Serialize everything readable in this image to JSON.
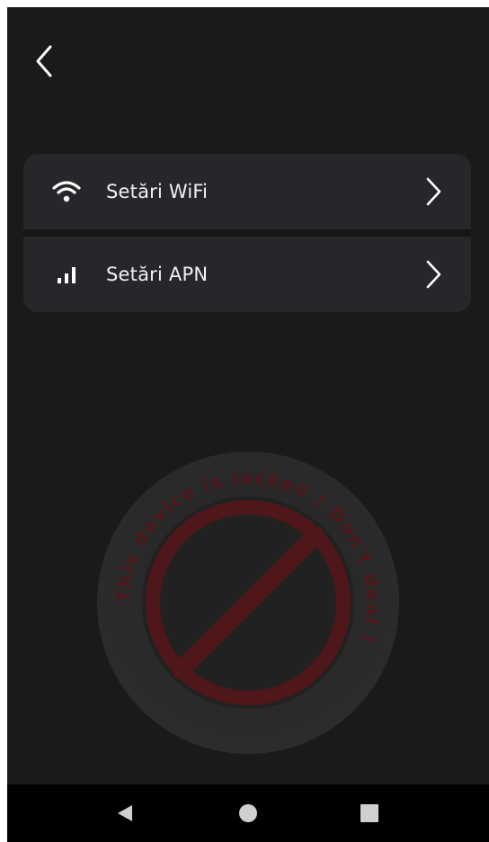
{
  "colors": {
    "background": "#1a1a1a",
    "card": "#26272b",
    "text": "#f1f1f1",
    "stamp_red": "#5a1a1c",
    "stamp_gray": "#2a2a2a",
    "nav_bar": "#000000"
  },
  "header": {
    "back_icon": "chevron-left-icon"
  },
  "menu": {
    "items": [
      {
        "label": "Setări WiFi",
        "icon": "wifi-icon",
        "chevron": "chevron-right-icon"
      },
      {
        "label": "Setări APN",
        "icon": "signal-bars-icon",
        "chevron": "chevron-right-icon"
      }
    ]
  },
  "watermark": {
    "icon": "prohibited-stamp-icon",
    "ring_text": "This device is locked ! Don't deal !"
  },
  "navbar": {
    "back": "triangle-back-icon",
    "home": "circle-home-icon",
    "recents": "square-recents-icon"
  }
}
